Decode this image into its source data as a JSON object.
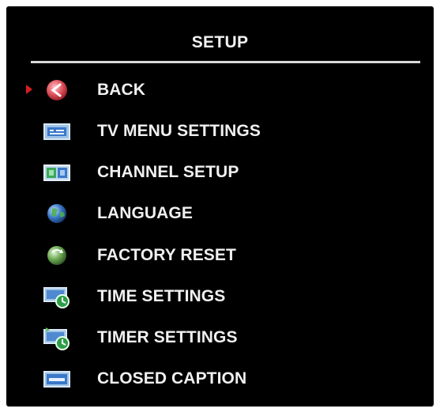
{
  "menu": {
    "title": "SETUP",
    "items": [
      {
        "label": "BACK",
        "icon": "back-icon"
      },
      {
        "label": "TV MENU SETTINGS",
        "icon": "tv-menu-icon"
      },
      {
        "label": "CHANNEL SETUP",
        "icon": "channel-setup-icon"
      },
      {
        "label": "LANGUAGE",
        "icon": "globe-icon"
      },
      {
        "label": "FACTORY RESET",
        "icon": "factory-reset-icon"
      },
      {
        "label": "TIME SETTINGS",
        "icon": "time-settings-icon"
      },
      {
        "label": "TIMER SETTINGS",
        "icon": "timer-settings-icon"
      },
      {
        "label": "CLOSED CAPTION",
        "icon": "closed-caption-icon"
      }
    ],
    "selected_index": 0
  },
  "colors": {
    "background": "#000000",
    "text": "#f0f0f0",
    "selection_arrow": "#d81e1e",
    "back_icon": "#e0505a",
    "icon_blue": "#3a78c8",
    "icon_green": "#3aa85a"
  }
}
